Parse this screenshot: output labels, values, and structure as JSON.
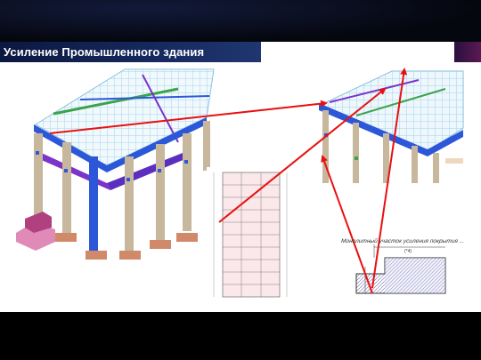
{
  "slide": {
    "title": "Усиление Промышленного здания",
    "section_caption": "Монолитный участок усиления покрытия ...",
    "section_dim": "(*4)"
  },
  "colors": {
    "banner": "#15285c",
    "arrow": "#e81010",
    "frame_blue": "#2c57d8",
    "column_tan": "#c7b79c",
    "purple_beam": "#7b33c9"
  },
  "icons": [
    "3d-model-image",
    "floor-plan-drawing",
    "detail-3d-image",
    "section-drawing",
    "pointer-arrow"
  ]
}
